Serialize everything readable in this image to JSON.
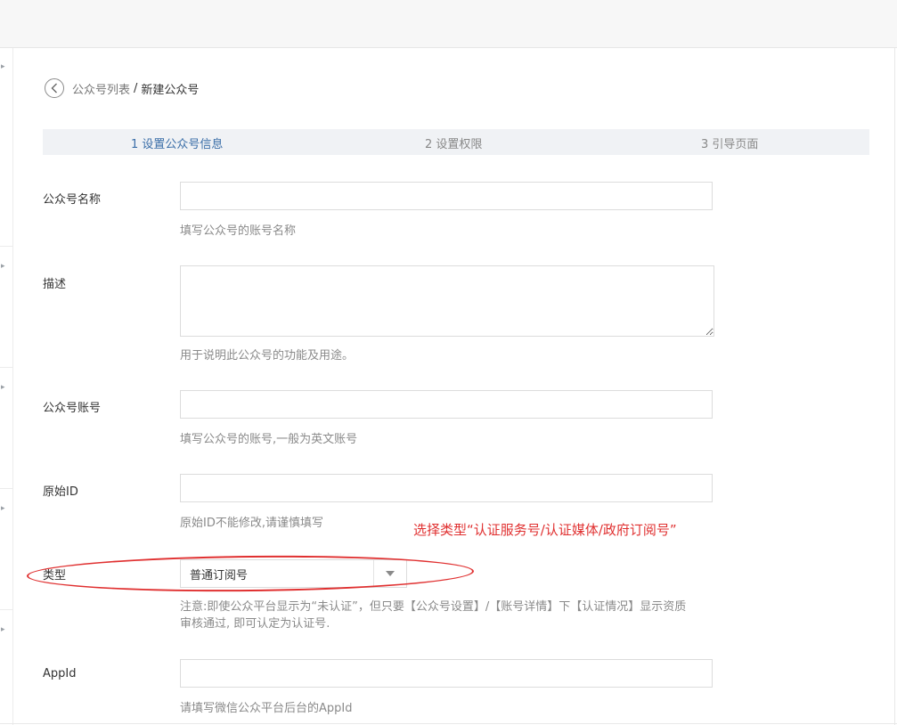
{
  "breadcrumb": {
    "back_icon": "chevron-left-icon",
    "parent": "公众号列表",
    "separator": "/",
    "current": "新建公众号"
  },
  "steps": [
    {
      "label": "1 设置公众号信息",
      "active": true
    },
    {
      "label": "2 设置权限",
      "active": false
    },
    {
      "label": "3 引导页面",
      "active": false
    }
  ],
  "form": {
    "name": {
      "label": "公众号名称",
      "value": "",
      "hint": "填写公众号的账号名称"
    },
    "description": {
      "label": "描述",
      "value": "",
      "hint": "用于说明此公众号的功能及用途。"
    },
    "account": {
      "label": "公众号账号",
      "value": "",
      "hint": "填写公众号的账号,一般为英文账号"
    },
    "original_id": {
      "label": "原始ID",
      "value": "",
      "hint": "原始ID不能修改,请谨慎填写"
    },
    "type": {
      "label": "类型",
      "selected": "普通订阅号",
      "hint_line1": "注意:即使公众平台显示为“未认证”，但只要【公众号设置】/【账号详情】下【认证情况】显示资质",
      "hint_line2": "审核通过, 即可认定为认证号."
    },
    "appid": {
      "label": "AppId",
      "value": "",
      "hint": "请填写微信公众平台后台的AppId"
    }
  },
  "annotation": {
    "text": "选择类型“认证服务号/认证媒体/政府订阅号”",
    "color": "#e03030"
  },
  "colors": {
    "active_step": "#3a6ea8",
    "steps_bg": "#f0f2f5",
    "topbar_bg": "#f7f7f7"
  }
}
